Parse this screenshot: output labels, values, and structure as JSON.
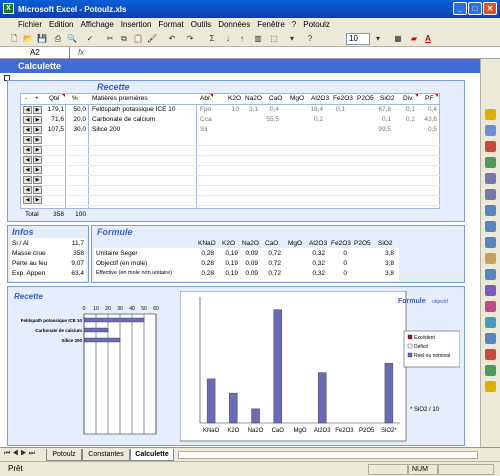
{
  "window": {
    "title": "Microsoft Excel - Potoulz.xls",
    "min": "_",
    "max": "□",
    "close": "✕"
  },
  "menu": [
    "Fichier",
    "Edition",
    "Affichage",
    "Insertion",
    "Format",
    "Outils",
    "Données",
    "Fenêtre",
    "?",
    "Potoulz"
  ],
  "toolbar": {
    "font_size": "10",
    "font_color_letter": "A"
  },
  "namebox": "A2",
  "sheet_title": "Calculette",
  "recette": {
    "title": "Recette",
    "col_minus": "-",
    "col_plus": "+",
    "col_qte": "Qté",
    "col_pct": "%",
    "col_matieres": "Matières premières",
    "col_abr": "Abr.",
    "oxide_cols": [
      "K2O",
      "Na2O",
      "CaO",
      "MgO",
      "Al2O3",
      "Fe2O3",
      "P2O5",
      "SiO2",
      "Div.",
      "PF"
    ],
    "rows": [
      {
        "qte": "179,1",
        "pct": "50,0",
        "name": "Feldspath potassique ICE 10",
        "abr": "Fpo",
        "vals": [
          "10",
          "3,1",
          "0,4",
          "",
          "18,4",
          "0,1",
          "",
          "67,8",
          "0,1",
          "0,4"
        ]
      },
      {
        "qte": "71,6",
        "pct": "20,0",
        "name": "Carbonate de calcium",
        "abr": "Cca",
        "vals": [
          "",
          "",
          "55,5",
          "",
          "0,2",
          "",
          "",
          "0,1",
          "0,2",
          "43,6"
        ]
      },
      {
        "qte": "107,5",
        "pct": "30,0",
        "name": "Silice 200",
        "abr": "Sil",
        "vals": [
          "",
          "",
          "",
          "",
          "",
          "",
          "",
          "99,5",
          "",
          "0,5"
        ]
      }
    ],
    "total_label": "Total",
    "total_qte": "358",
    "total_pct": "100"
  },
  "infos": {
    "title": "Infos",
    "items": [
      {
        "label": "Si / Al",
        "value": "11,7"
      },
      {
        "label": "Masse crue",
        "value": "358"
      },
      {
        "label": "Perte  au feu",
        "value": "9,07"
      },
      {
        "label": "Exp. Appen",
        "value": "63,4"
      }
    ]
  },
  "formule": {
    "title": "Formule",
    "cols": [
      "KNaO",
      "K2O",
      "Na2O",
      "CaO",
      "MgO",
      "Al2O3",
      "Fe2O3",
      "P2O5",
      "SiO2"
    ],
    "rows": [
      {
        "label": "Unitaire Seger",
        "vals": [
          "0,28",
          "0,19",
          "0,09",
          "0,72",
          "",
          "0,32",
          "0",
          "",
          "3,8"
        ]
      },
      {
        "label": "Objectif (en mole)",
        "vals": [
          "0,28",
          "0,19",
          "0,09",
          "0,72",
          "",
          "0,32",
          "0",
          "",
          "3,8"
        ]
      },
      {
        "label": "Effective (en mole non unitaire)",
        "vals": [
          "0,28",
          "0,19",
          "0,09",
          "0,72",
          "",
          "0,32",
          "0",
          "",
          "3,8"
        ]
      }
    ]
  },
  "chart_data": [
    {
      "type": "bar",
      "title": "Recette",
      "orientation": "horizontal",
      "categories": [
        "Feldspath potassique ICE 10",
        "Carbonate de calcium",
        "Silice 200"
      ],
      "values": [
        50,
        20,
        30
      ],
      "xlim": [
        0,
        60
      ],
      "xticks": [
        "0",
        "10",
        "20",
        "30",
        "40",
        "50",
        "60"
      ]
    },
    {
      "type": "bar",
      "title": "Formule",
      "subtitle": "objectif",
      "categories": [
        "KNaO",
        "K2O",
        "Na2O",
        "CaO",
        "MgO",
        "Al2O3",
        "Fe2O3",
        "P2O5",
        "SiO2*"
      ],
      "series": [
        {
          "name": "Réel ou nominal",
          "values": [
            0.28,
            0.19,
            0.09,
            0.72,
            0,
            0.32,
            0,
            0,
            0.38
          ]
        }
      ],
      "ylim": [
        0,
        0.8
      ],
      "legend": [
        "Excédent",
        "Déficit",
        "Réel ou nominal"
      ],
      "legend_colors": [
        "#8B1A1A",
        "#FFFFFF",
        "#6B6BB8"
      ],
      "note": "* SiO2 / 10"
    }
  ],
  "sheet_tabs": [
    "Potoulz",
    "Constantes",
    "Calculette"
  ],
  "status": {
    "ready": "Prêt",
    "num": "NUM"
  },
  "colors": {
    "accent": "#3F6CD8",
    "bar": "#6B6BB8",
    "panel_border": "#7B9BD6"
  }
}
